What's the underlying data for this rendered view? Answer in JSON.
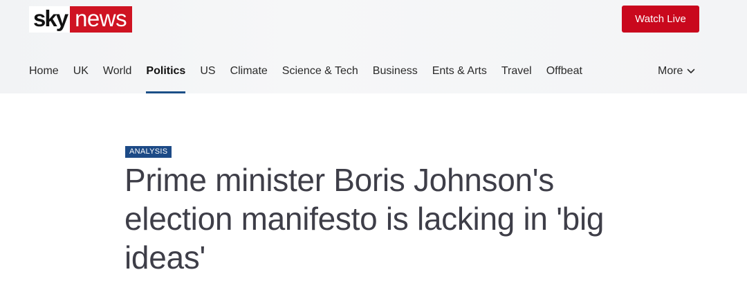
{
  "header": {
    "logo": {
      "sky": "sky",
      "news": "news"
    },
    "watch_live_label": "Watch Live"
  },
  "nav": {
    "items": [
      {
        "label": "Home"
      },
      {
        "label": "UK"
      },
      {
        "label": "World"
      },
      {
        "label": "Politics",
        "active": true
      },
      {
        "label": "US"
      },
      {
        "label": "Climate"
      },
      {
        "label": "Science & Tech"
      },
      {
        "label": "Business"
      },
      {
        "label": "Ents & Arts"
      },
      {
        "label": "Travel"
      },
      {
        "label": "Offbeat"
      }
    ],
    "more_label": "More",
    "more_icon": "chevron-down-icon"
  },
  "article": {
    "tag": "ANALYSIS",
    "headline": "Prime minister Boris Johnson's election manifesto is lacking in 'big ideas'"
  },
  "colors": {
    "brand_red": "#c9081d",
    "nav_active_underline": "#1b4f87",
    "tag_background": "#1c4a86",
    "headline_text": "#3e3e48"
  }
}
